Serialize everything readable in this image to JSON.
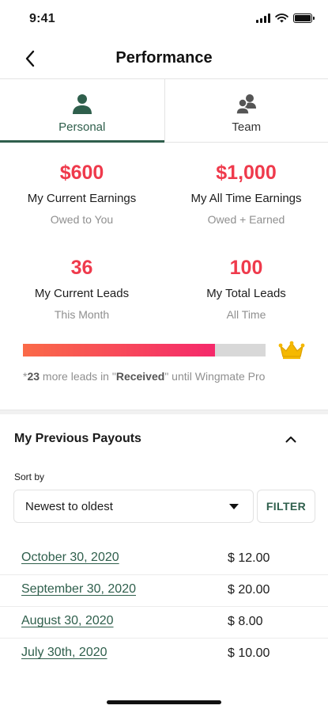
{
  "status_bar": {
    "time": "9:41"
  },
  "header": {
    "title": "Performance",
    "back_icon": "chevron-left-icon"
  },
  "tabs": [
    {
      "label": "Personal",
      "icon": "person-icon",
      "active": true
    },
    {
      "label": "Team",
      "icon": "group-icon",
      "active": false
    }
  ],
  "stats": {
    "current_earnings": {
      "value": "$600",
      "label": "My Current Earnings",
      "sub": "Owed to You"
    },
    "all_time_earnings": {
      "value": "$1,000",
      "label": "My All Time Earnings",
      "sub": "Owed + Earned"
    },
    "current_leads": {
      "value": "36",
      "label": "My Current Leads",
      "sub": "This Month"
    },
    "total_leads": {
      "value": "100",
      "label": "My Total Leads",
      "sub": "All Time"
    }
  },
  "progress": {
    "fraction": 0.79,
    "icon": "crown-icon",
    "note_prefix": "*",
    "note_count": "23",
    "note_middle": " more leads in \"",
    "note_status": "Received",
    "note_suffix": "\" until Wingmate Pro"
  },
  "payouts": {
    "title": "My Previous Payouts",
    "collapse_icon": "chevron-up-icon",
    "sort_label": "Sort by",
    "sort_value": "Newest to oldest",
    "filter_label": "FILTER",
    "rows": [
      {
        "date": "October 30, 2020",
        "amount": "$ 12.00"
      },
      {
        "date": "September 30, 2020",
        "amount": "$ 20.00"
      },
      {
        "date": "August 30, 2020",
        "amount": "$ 8.00"
      },
      {
        "date": "July 30th, 2020",
        "amount": "$ 10.00"
      }
    ]
  },
  "colors": {
    "accent_green": "#2f5f4c",
    "value_red": "#ef3a4c",
    "crown_gold": "#f5b800"
  }
}
